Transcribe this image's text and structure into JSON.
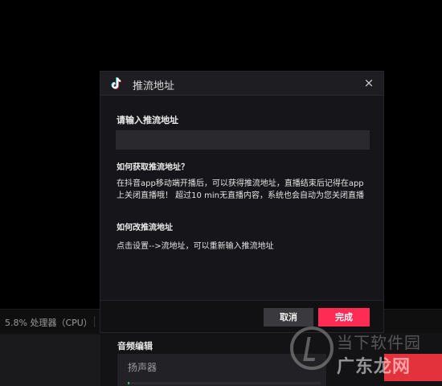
{
  "status_bar": {
    "cpu_text": "5.8% 处理器（CPU）"
  },
  "audio": {
    "section_title": "音频编辑",
    "speaker_label": "扬声器",
    "meter_level": 0.01
  },
  "dialog": {
    "title": "推流地址",
    "close_symbol": "×",
    "logo_icon": "tiktok-logo-icon",
    "field_label": "请输入推流地址",
    "input": {
      "value": "",
      "placeholder": ""
    },
    "faq1_title": "如何获取推流地址？",
    "faq1_body": "在抖音app移动端开播后，可以获得推流地址，直播结束后记得在app上关闭直播哦！ 超过10 min无直播内容，系统也会自动为您关闭直播",
    "faq2_title": "如何改推流地址",
    "faq2_body": "点击设置-->流地址，可以重新输入推流地址",
    "cancel_label": "取消",
    "done_label": "完成"
  },
  "watermark": {
    "line1": "当下软件园",
    "line2": "广东龙网"
  },
  "colors": {
    "accent": "#fe2c55",
    "dialog_bg": "#16161a",
    "input_bg": "#2a2a2e",
    "cancel_bg": "#3a3a3e"
  }
}
